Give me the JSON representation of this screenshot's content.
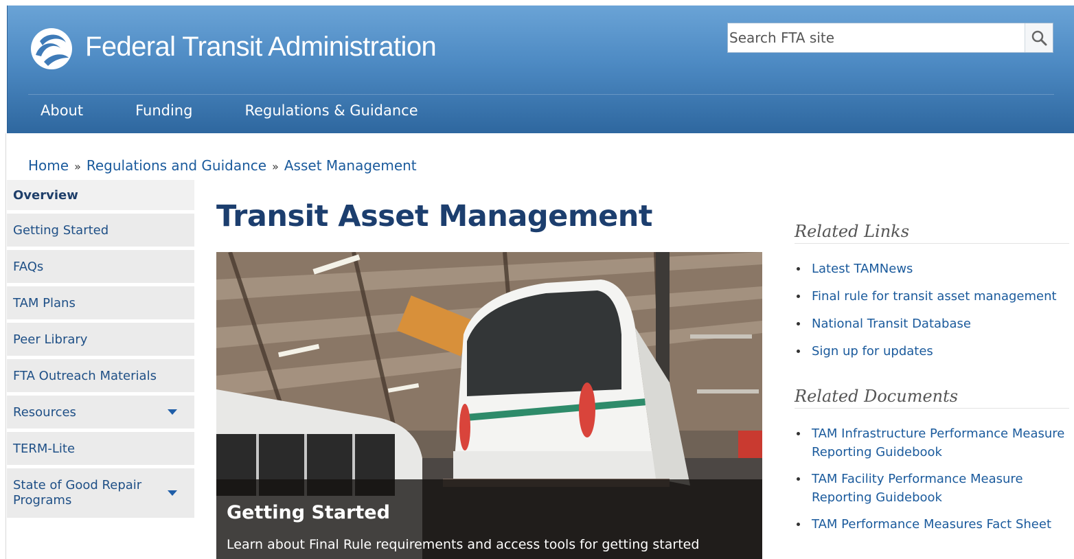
{
  "header": {
    "site_title": "Federal Transit Administration",
    "search_placeholder": "Search FTA site",
    "search_icon": "magnifier-icon",
    "logo_icon": "fta-logo-icon",
    "nav": [
      "About",
      "Funding",
      "Regulations & Guidance"
    ]
  },
  "breadcrumb": {
    "items": [
      "Home",
      "Regulations and Guidance",
      "Asset Management"
    ],
    "separator": "»"
  },
  "sidebar": {
    "items": [
      {
        "label": "Overview",
        "active": true
      },
      {
        "label": "Getting Started"
      },
      {
        "label": "FAQs"
      },
      {
        "label": "TAM Plans"
      },
      {
        "label": "Peer Library"
      },
      {
        "label": "FTA Outreach Materials"
      },
      {
        "label": "Resources",
        "expandable": true
      },
      {
        "label": "TERM-Lite"
      },
      {
        "label": "State of Good Repair Programs",
        "expandable": true
      }
    ]
  },
  "main": {
    "page_title": "Transit Asset Management",
    "hero": {
      "heading": "Getting Started",
      "text": "Learn about Final Rule requirements and access tools for getting started"
    }
  },
  "right": {
    "related_links_heading": "Related Links",
    "related_links": [
      "Latest TAMNews",
      "Final rule for transit asset management",
      "National Transit Database",
      "Sign up for updates"
    ],
    "related_docs_heading": "Related Documents",
    "related_docs": [
      [
        "TAM Infrastructure Performance Measure",
        "Reporting Guidebook"
      ],
      [
        "TAM Facility Performance Measure",
        "Reporting Guidebook"
      ],
      [
        "TAM Performance Measures Fact Sheet"
      ]
    ]
  },
  "colors": {
    "header_top": "#6aa3d6",
    "header_bottom": "#2e679f",
    "link": "#1a5a9c",
    "title": "#1c3e6e",
    "sidebar_bg": "#ebebeb"
  }
}
